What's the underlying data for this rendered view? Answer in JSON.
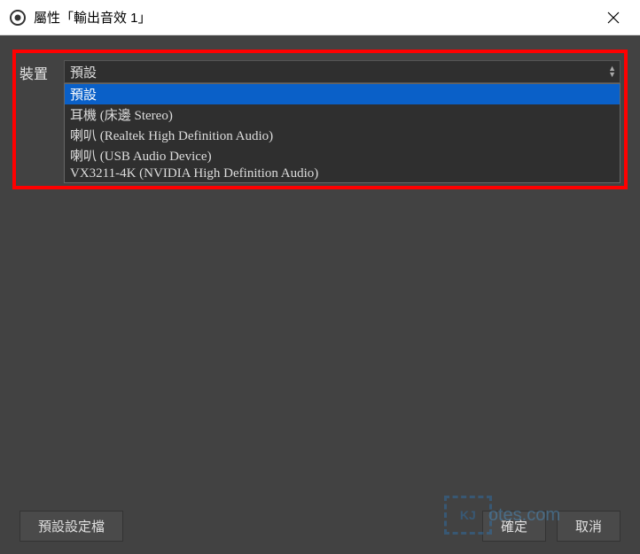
{
  "window": {
    "title": "屬性「輸出音效 1」"
  },
  "property": {
    "label": "裝置",
    "selected": "預設",
    "options": [
      "預設",
      "耳機 (床邊 Stereo)",
      "喇叭 (Realtek High Definition Audio)",
      "喇叭 (USB Audio Device)",
      "VX3211-4K (NVIDIA High Definition Audio)"
    ]
  },
  "buttons": {
    "preset": "預設設定檔",
    "ok": "確定",
    "cancel": "取消"
  },
  "watermark": {
    "boxText": "KJ",
    "text": "otes.com"
  }
}
